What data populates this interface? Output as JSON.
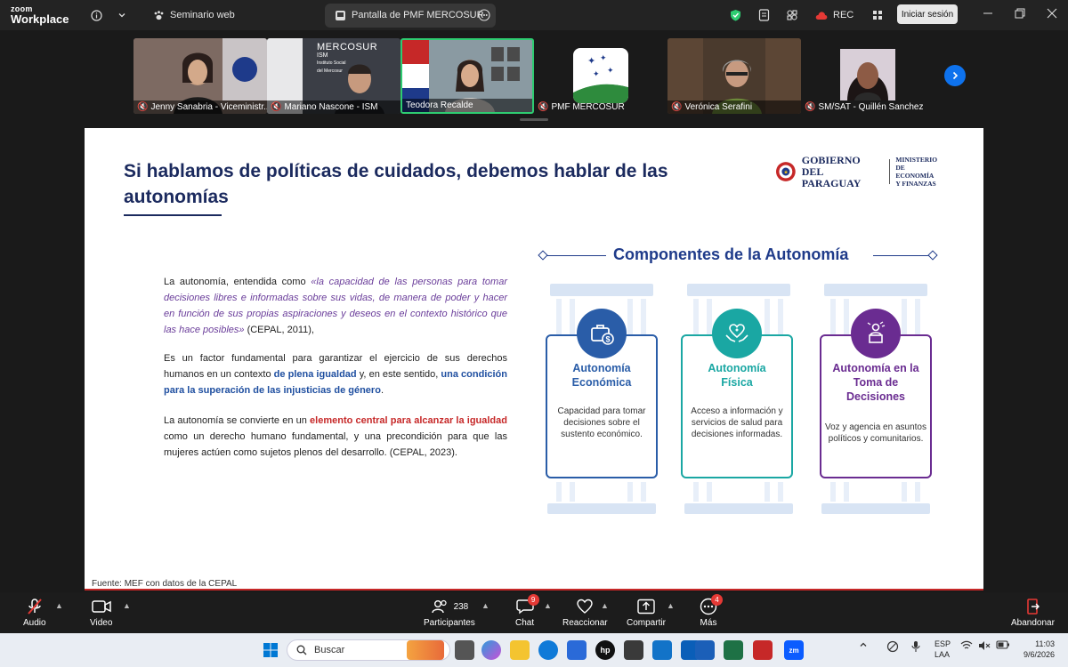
{
  "app": {
    "logo_line1": "zoom",
    "logo_line2": "Workplace"
  },
  "topbar": {
    "tab1_label": "Seminario web",
    "tab2_label": "Pantalla de PMF MERCOSUR",
    "rec_label": "REC",
    "signin_label": "Iniciar sesión"
  },
  "participants": [
    {
      "name": "Jenny Sanabria - Viceministr..."
    },
    {
      "name": "Mariano Nascone - ISM"
    },
    {
      "name": "Teodora Recalde"
    },
    {
      "name": "PMF MERCOSUR"
    },
    {
      "name": "Verónica Serafini"
    },
    {
      "name": "SM/SAT - Quillén Sanchez"
    }
  ],
  "mercosur_tile": {
    "line1": "MERCOSUR",
    "line2": "ISM",
    "line3": "Instituto Social",
    "line4": "del Mercosur"
  },
  "slide": {
    "title_line1": "Si hablamos de políticas de cuidados, debemos hablar de las",
    "title_line2": "autonomías",
    "logo_name_1": "GOBIERNO DEL",
    "logo_name_2": "PARAGUAY",
    "logo_ministry_1": "MINISTERIO",
    "logo_ministry_2": "DE ECONOMÍA",
    "logo_ministry_3": "Y FINANZAS",
    "p1_a": "La autonomía, entendida como ",
    "p1_quote": "«la capacidad de las personas para tomar decisiones libres e informadas sobre sus vidas, de manera de poder y hacer en función de sus propias aspiraciones y deseos en el contexto histórico que las hace posibles»",
    "p1_b": " (CEPAL, 2011),",
    "p2_a": "Es un factor fundamental para garantizar el ejercicio de sus derechos humanos en un contexto ",
    "p2_bold1": "de plena igualdad",
    "p2_b": " y, en este sentido, ",
    "p2_bold2": "una condición para la superación de las injusticias de género",
    "p2_c": ".",
    "p3_a": "La autonomía se convierte en un ",
    "p3_bold": "elemento central para alcanzar la igualdad",
    "p3_b": " como un derecho humano fundamental, y una precondición para que las mujeres actúen como sujetos plenos del desarrollo. (CEPAL, 2023).",
    "source": "Fuente: MEF con datos de la CEPAL",
    "components_title": "Componentes de la Autonomía",
    "cards": [
      {
        "head1": "Autonomía",
        "head2": "Económica",
        "desc": "Capacidad para tomar decisiones sobre el sustento económico.",
        "color": "#2a5da8",
        "icon": "briefcase-money-icon"
      },
      {
        "head1": "Autonomía",
        "head2": "Física",
        "desc": "Acceso a información y servicios de salud para decisiones informadas.",
        "color": "#1aa7a3",
        "icon": "heart-hands-icon"
      },
      {
        "head1": "Autonomía en la Toma de",
        "head2": "Decisiones",
        "desc": "Voz y agencia en asuntos políticos y comunitarios.",
        "color": "#6a2c91",
        "icon": "speaker-podium-icon"
      }
    ]
  },
  "controls": {
    "audio": "Audio",
    "video": "Video",
    "participants": "Participantes",
    "participants_count": "238",
    "chat": "Chat",
    "chat_badge": "9",
    "react": "Reaccionar",
    "share": "Compartir",
    "more": "Más",
    "more_badge": "4",
    "leave": "Abandonar"
  },
  "taskbar": {
    "search_placeholder": "Buscar",
    "lang1": "ESP",
    "lang2": "LAA",
    "time": "11:03",
    "date": "9/6/2026"
  },
  "colors": {
    "accent_blue": "#0e72ed",
    "slide_title": "#1b2a5e",
    "active_speaker_border": "#2ecc71"
  }
}
